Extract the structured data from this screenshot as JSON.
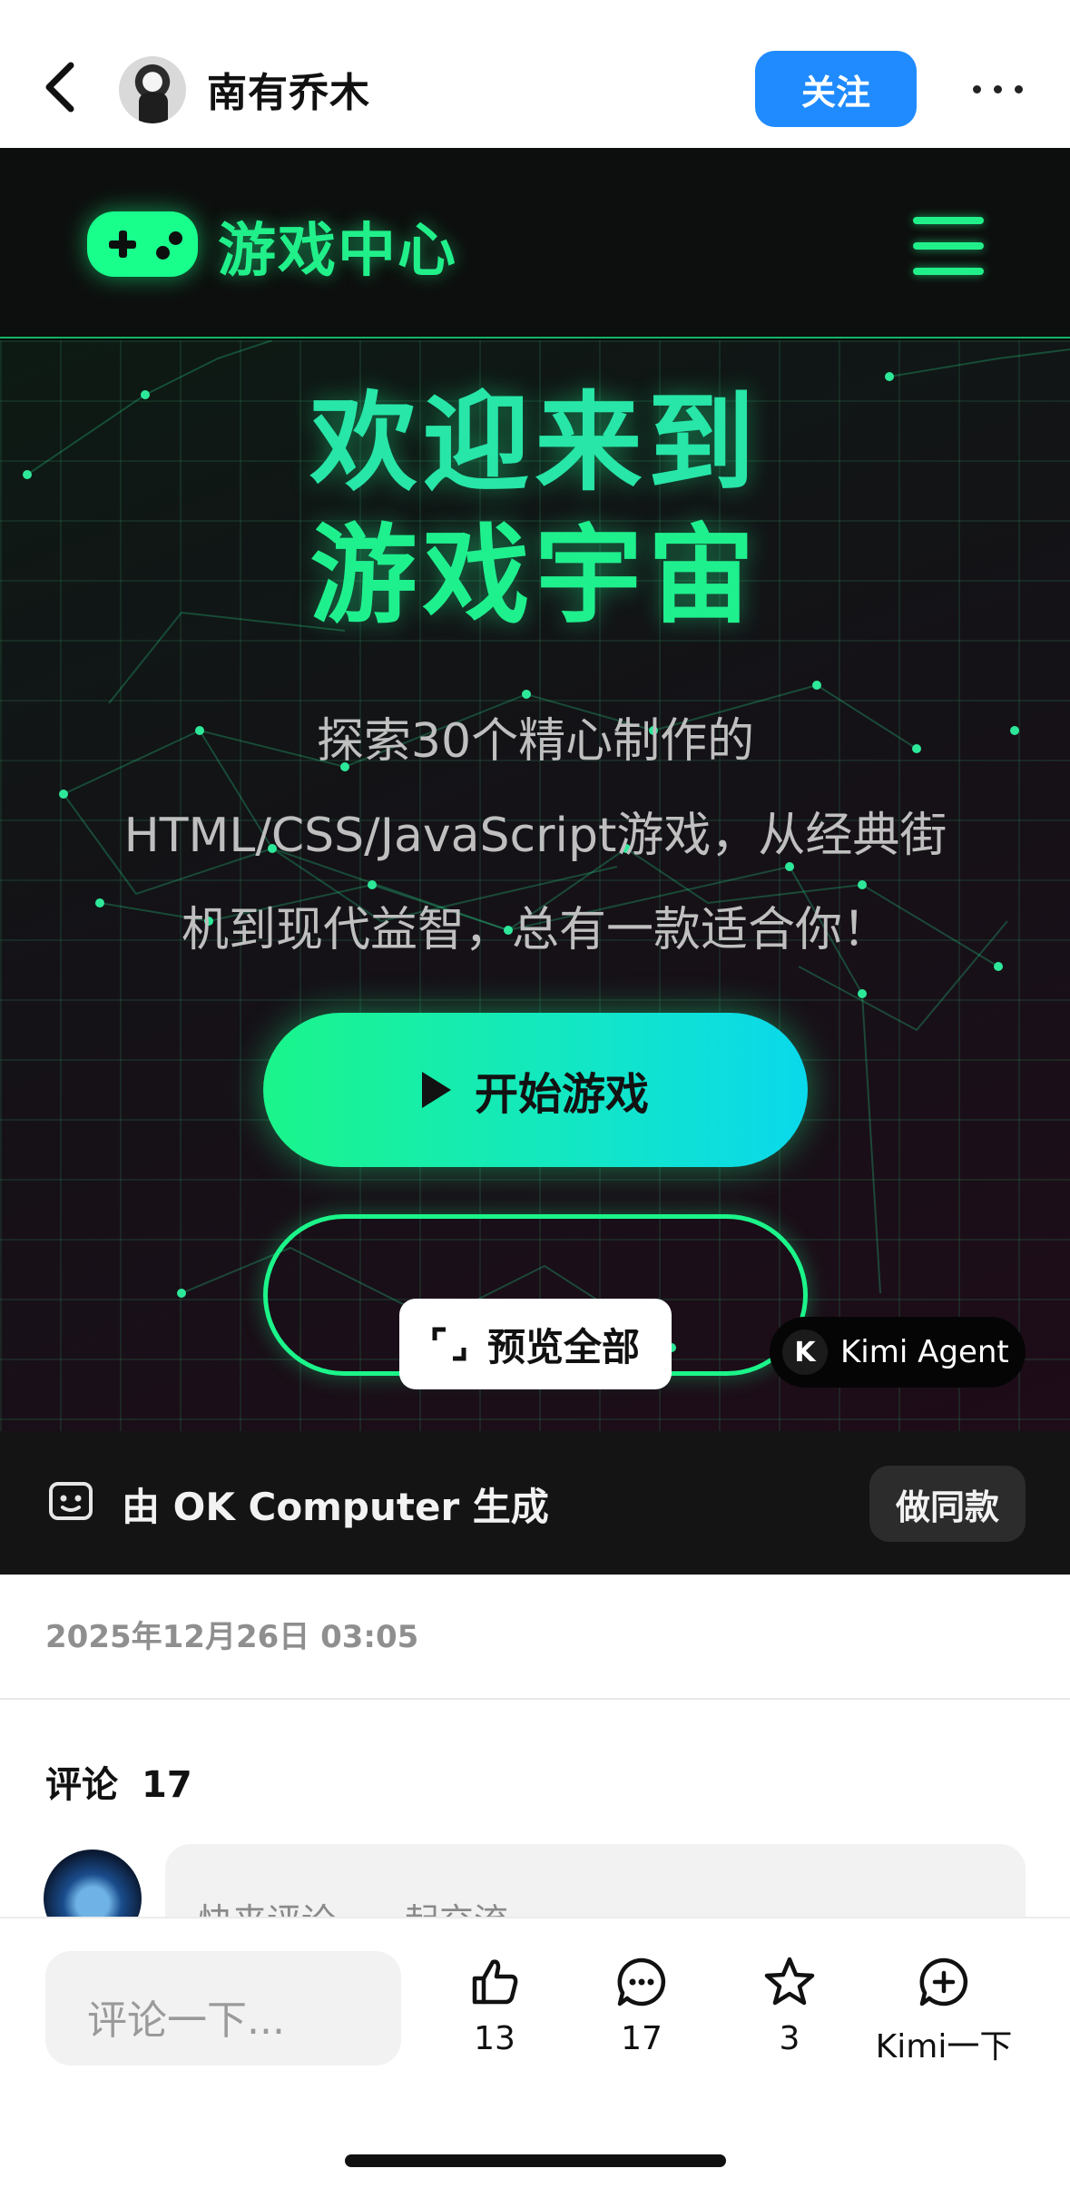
{
  "header": {
    "username": "南有乔木",
    "follow_label": "关注"
  },
  "game": {
    "brand": "游戏中心",
    "hero_title_line1": "欢迎来到",
    "hero_title_line2": "游戏宇宙",
    "desc_line1": "探索30个精心制作的",
    "desc_line2": "HTML/CSS/JavaScript游戏，从经典街",
    "desc_line3": "机到现代益智，总有一款适合你！",
    "start_label": "开始游戏",
    "overview_label": "预览全部",
    "agent_label": "Kimi Agent",
    "agent_logo": "K",
    "generated_by": "由 OK Computer 生成",
    "same_label": "做同款"
  },
  "post": {
    "date": "2025年12月26日 03:05"
  },
  "comments": {
    "title": "评论",
    "count": "17",
    "input_placeholder": "快来评论，一起交流"
  },
  "bottom": {
    "reply_placeholder": "评论一下...",
    "likes": "13",
    "comments": "17",
    "favorites": "3",
    "kimi_label": "Kimi一下"
  },
  "colors": {
    "accent_blue": "#1f8bff",
    "neon_green": "#1ff08e",
    "cyan": "#0ad8ec"
  },
  "icons": [
    "back-arrow-icon",
    "more-dots-icon",
    "gamepad-icon",
    "menu-icon",
    "play-icon",
    "expand-icon",
    "robot-icon",
    "thumb-up-icon",
    "comment-icon",
    "star-icon",
    "add-circle-icon"
  ]
}
